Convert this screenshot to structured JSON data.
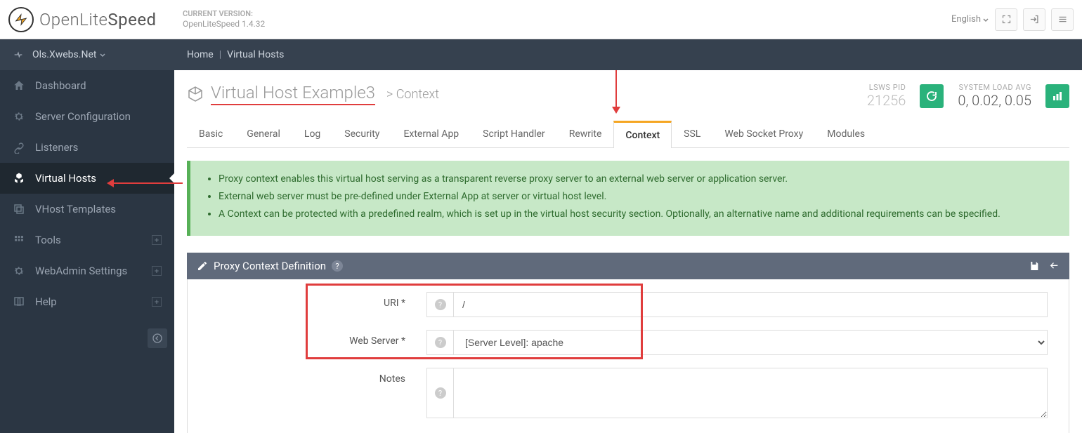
{
  "brand": {
    "name_light": "Open",
    "name_mid": "Lite",
    "name_dark": "Speed"
  },
  "version": {
    "label": "CURRENT VERSION:",
    "value": "OpenLiteSpeed 1.4.32"
  },
  "language": "English",
  "sidebar": {
    "host": "Ols.Xwebs.Net",
    "items": [
      {
        "label": "Dashboard"
      },
      {
        "label": "Server Configuration"
      },
      {
        "label": "Listeners"
      },
      {
        "label": "Virtual Hosts"
      },
      {
        "label": "VHost Templates"
      },
      {
        "label": "Tools"
      },
      {
        "label": "WebAdmin Settings"
      },
      {
        "label": "Help"
      }
    ]
  },
  "breadcrumb": {
    "home": "Home",
    "current": "Virtual Hosts"
  },
  "page": {
    "title": "Virtual Host Example3",
    "subtitle": "Context",
    "pid_label": "LSWS PID",
    "pid_value": "21256",
    "load_label": "SYSTEM LOAD AVG",
    "load_value": "0, 0.02, 0.05"
  },
  "tabs": [
    "Basic",
    "General",
    "Log",
    "Security",
    "External App",
    "Script Handler",
    "Rewrite",
    "Context",
    "SSL",
    "Web Socket Proxy",
    "Modules"
  ],
  "active_tab": "Context",
  "greenbox": [
    "Proxy context enables this virtual host serving as a transparent reverse proxy server to an external web server or application server.",
    "External web server must be pre-defined under External App at server or virtual host level.",
    "A Context can be protected with a predefined realm, which is set up in the virtual host security section. Optionally, an alternative name and additional requirements can be specified."
  ],
  "panel": {
    "title": "Proxy Context Definition",
    "fields": {
      "uri": {
        "label": "URI *",
        "value": "/"
      },
      "webserver": {
        "label": "Web Server *",
        "value": "[Server Level]: apache"
      },
      "notes": {
        "label": "Notes",
        "value": ""
      }
    }
  }
}
